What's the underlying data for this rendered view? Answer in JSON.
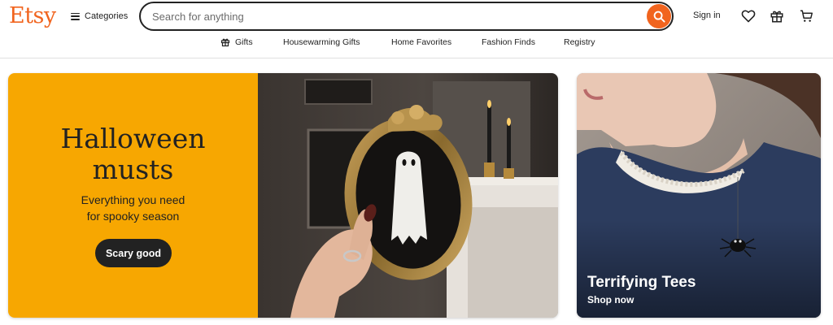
{
  "header": {
    "logo": "Etsy",
    "categories_label": "Categories",
    "search_placeholder": "Search for anything",
    "signin_label": "Sign in",
    "icons": [
      "heart-icon",
      "gift-icon",
      "cart-icon"
    ]
  },
  "subnav": {
    "items": [
      {
        "label": "Gifts",
        "icon": "gift-icon"
      },
      {
        "label": "Housewarming Gifts"
      },
      {
        "label": "Home Favorites"
      },
      {
        "label": "Fashion Finds"
      },
      {
        "label": "Registry"
      }
    ]
  },
  "hero": {
    "title_line1": "Halloween",
    "title_line2": "musts",
    "subtitle_line1": "Everything you need",
    "subtitle_line2": "for spooky season",
    "button_label": "Scary good"
  },
  "side_card": {
    "title": "Terrifying Tees",
    "link_label": "Shop now"
  },
  "colors": {
    "brand": "#f1641e",
    "hero_bg": "#f7a701",
    "dark": "#222222"
  }
}
